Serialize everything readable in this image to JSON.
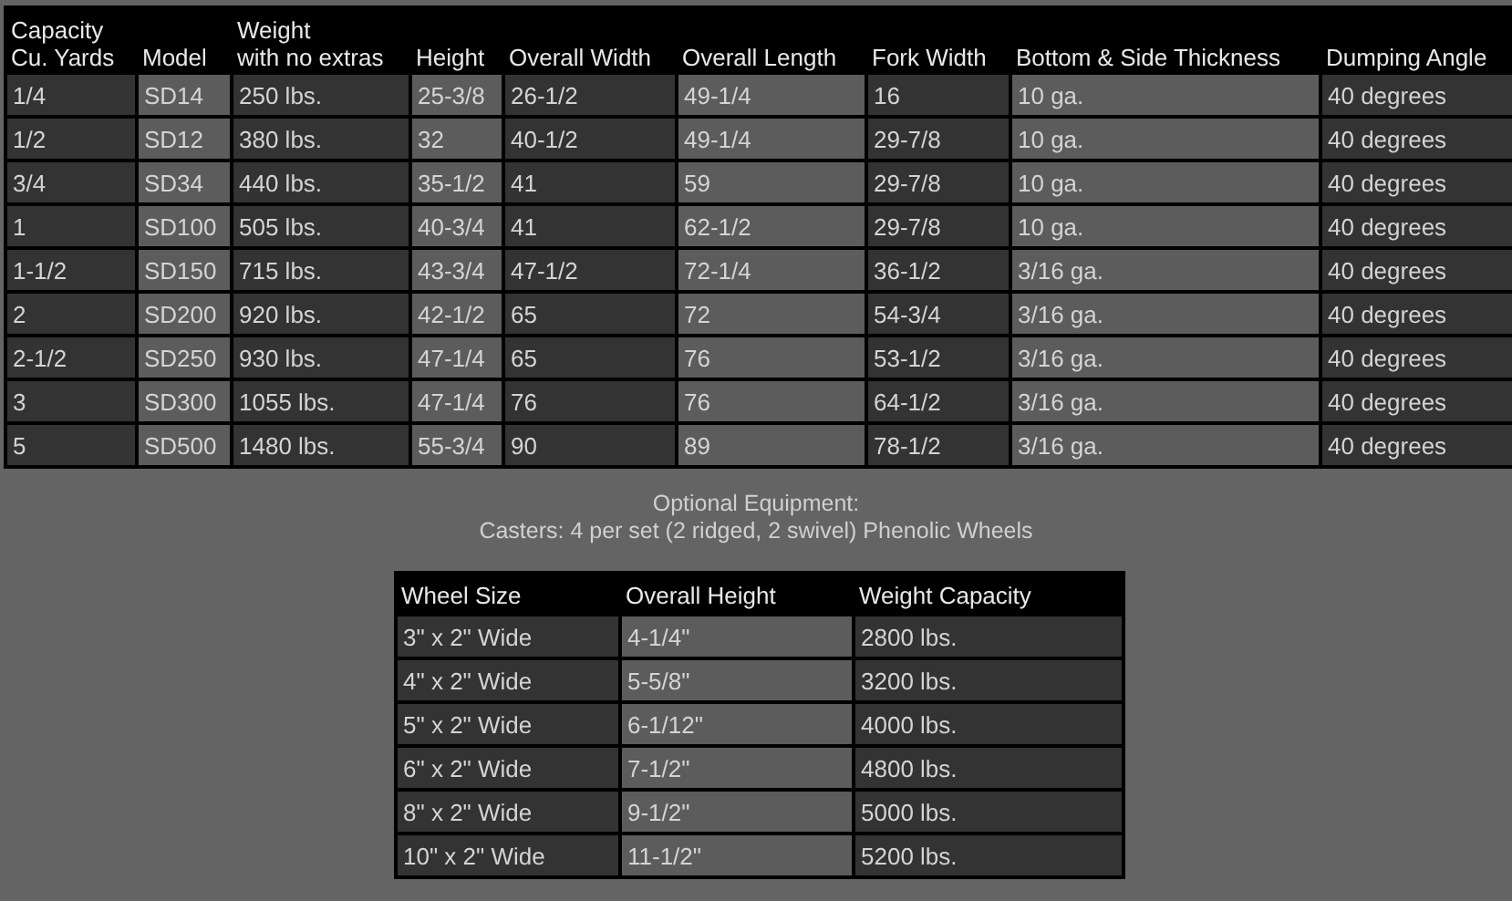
{
  "specs_table": {
    "columns": [
      "Capacity\nCu. Yards",
      "Model",
      "Weight\nwith no extras",
      "Height",
      "Overall Width",
      "Overall Length",
      "Fork Width",
      "Bottom & Side Thickness",
      "Dumping Angle"
    ],
    "rows": [
      [
        "1/4",
        "SD14",
        "250 lbs.",
        "25-3/8",
        "26-1/2",
        "49-1/4",
        "16",
        "10 ga.",
        "40 degrees"
      ],
      [
        "1/2",
        "SD12",
        "380 lbs.",
        "32",
        "40-1/2",
        "49-1/4",
        "29-7/8",
        "10 ga.",
        "40 degrees"
      ],
      [
        "3/4",
        "SD34",
        "440 lbs.",
        "35-1/2",
        "41",
        "59",
        "29-7/8",
        "10 ga.",
        "40 degrees"
      ],
      [
        "1",
        "SD100",
        "505 lbs.",
        "40-3/4",
        "41",
        "62-1/2",
        "29-7/8",
        "10 ga.",
        "40 degrees"
      ],
      [
        "1-1/2",
        "SD150",
        "715 lbs.",
        "43-3/4",
        "47-1/2",
        "72-1/4",
        "36-1/2",
        "3/16 ga.",
        "40 degrees"
      ],
      [
        "2",
        "SD200",
        "920 lbs.",
        "42-1/2",
        "65",
        "72",
        "54-3/4",
        "3/16 ga.",
        "40 degrees"
      ],
      [
        "2-1/2",
        "SD250",
        "930 lbs.",
        "47-1/4",
        "65",
        "76",
        "53-1/2",
        "3/16 ga.",
        "40 degrees"
      ],
      [
        "3",
        "SD300",
        "1055 lbs.",
        "47-1/4",
        "76",
        "76",
        "64-1/2",
        "3/16 ga.",
        "40 degrees"
      ],
      [
        "5",
        "SD500",
        "1480 lbs.",
        "55-3/4",
        "90",
        "89",
        "78-1/2",
        "3/16 ga.",
        "40 degrees"
      ]
    ]
  },
  "optional": {
    "title": "Optional Equipment:",
    "description": "Casters: 4 per set (2 ridged, 2 swivel) Phenolic Wheels"
  },
  "casters_table": {
    "columns": [
      "Wheel Size",
      "Overall Height",
      "Weight Capacity"
    ],
    "rows": [
      [
        "3\" x 2\" Wide",
        "4-1/4\"",
        "2800 lbs."
      ],
      [
        "4\" x 2\" Wide",
        "5-5/8\"",
        "3200 lbs."
      ],
      [
        "5\" x 2\" Wide",
        "6-1/12\"",
        "4000 lbs."
      ],
      [
        "6\" x 2\" Wide",
        "7-1/2\"",
        "4800 lbs."
      ],
      [
        "8\" x 2\" Wide",
        "9-1/2\"",
        "5000 lbs."
      ],
      [
        "10\" x 2\" Wide",
        "11-1/2\"",
        "5200 lbs."
      ]
    ]
  }
}
